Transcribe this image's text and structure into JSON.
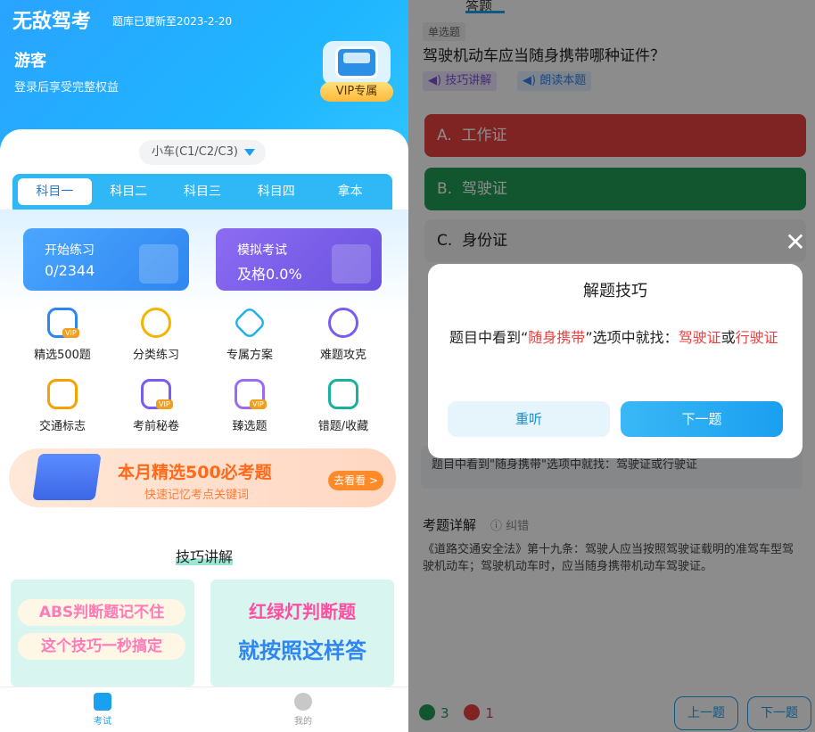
{
  "left": {
    "header": {
      "title": "无敌驾考",
      "updated": "题库已更新至2023-2-20",
      "guest": "游客",
      "login_hint": "登录后享受完整权益",
      "vip_badge": "VIP专属"
    },
    "vehicle_selector": "小车(C1/C2/C3)",
    "tabs": [
      "科目一",
      "科目二",
      "科目三",
      "科目四",
      "拿本"
    ],
    "practice": {
      "label": "开始练习",
      "value": "0/2344"
    },
    "mock": {
      "label": "模拟考试",
      "value": "及格0.0%"
    },
    "grid": [
      {
        "label": "精选500题",
        "icon": "500-vip-icon"
      },
      {
        "label": "分类练习",
        "icon": "four-circles-icon"
      },
      {
        "label": "专属方案",
        "icon": "diamond-icon"
      },
      {
        "label": "难题攻克",
        "icon": "target-icon"
      },
      {
        "label": "交通标志",
        "icon": "bus-icon"
      },
      {
        "label": "考前秘卷",
        "icon": "paper-icon"
      },
      {
        "label": "臻选题",
        "icon": "badge-check-icon"
      },
      {
        "label": "错题/收藏",
        "icon": "wrong-notes-icon"
      }
    ],
    "banner": {
      "title": "本月精选500必考题",
      "subtitle": "快速记忆考点关键词",
      "button": "去看看 >"
    },
    "skills_heading": "技巧讲解",
    "thumb1": {
      "line1": "ABS判断题记不住",
      "line2": "这个技巧一秒搞定"
    },
    "thumb2": {
      "line1": "红绿灯判断题",
      "line2": "就按照这样答"
    },
    "bottom_nav": {
      "exam": "考试",
      "mine": "我的"
    },
    "colors": {
      "primary": "#1aa0f0",
      "orange": "#ff6a1a"
    }
  },
  "right": {
    "tab": "答题",
    "question_type": "单选题",
    "question": "驾驶机动车应当随身携带哪种证件？",
    "chip_skill": "技巧讲解",
    "chip_read": "朗读本题",
    "options": [
      {
        "key": "A.",
        "text": "工作证",
        "state": "wrong"
      },
      {
        "key": "B.",
        "text": "驾驶证",
        "state": "correct"
      },
      {
        "key": "C.",
        "text": "身份证",
        "state": "neutral"
      }
    ],
    "explanation_box": "题目中看到\"随身携带\"选项中就找：驾驶证或行驶证",
    "detail_heading": "考题详解",
    "report": "纠错",
    "detail_body": "《道路交通安全法》第十九条：驾驶人应当按照驾驶证载明的准驾车型驾驶机动车；驾驶机动车时，应当随身携带机动车驾驶证。",
    "correct_count": "3",
    "wrong_count": "1",
    "prev": "上一题",
    "next": "下一题",
    "dialog": {
      "title": "解题技巧",
      "p1": "题目中看到“",
      "p2": "随身携带",
      "p3": "”选项中就找：",
      "p4": "驾驶证",
      "p5": "或",
      "p6": "行驶证",
      "again": "重听",
      "next": "下一题"
    },
    "colors": {
      "wrong": "#e84141",
      "correct": "#1f9d55"
    }
  }
}
